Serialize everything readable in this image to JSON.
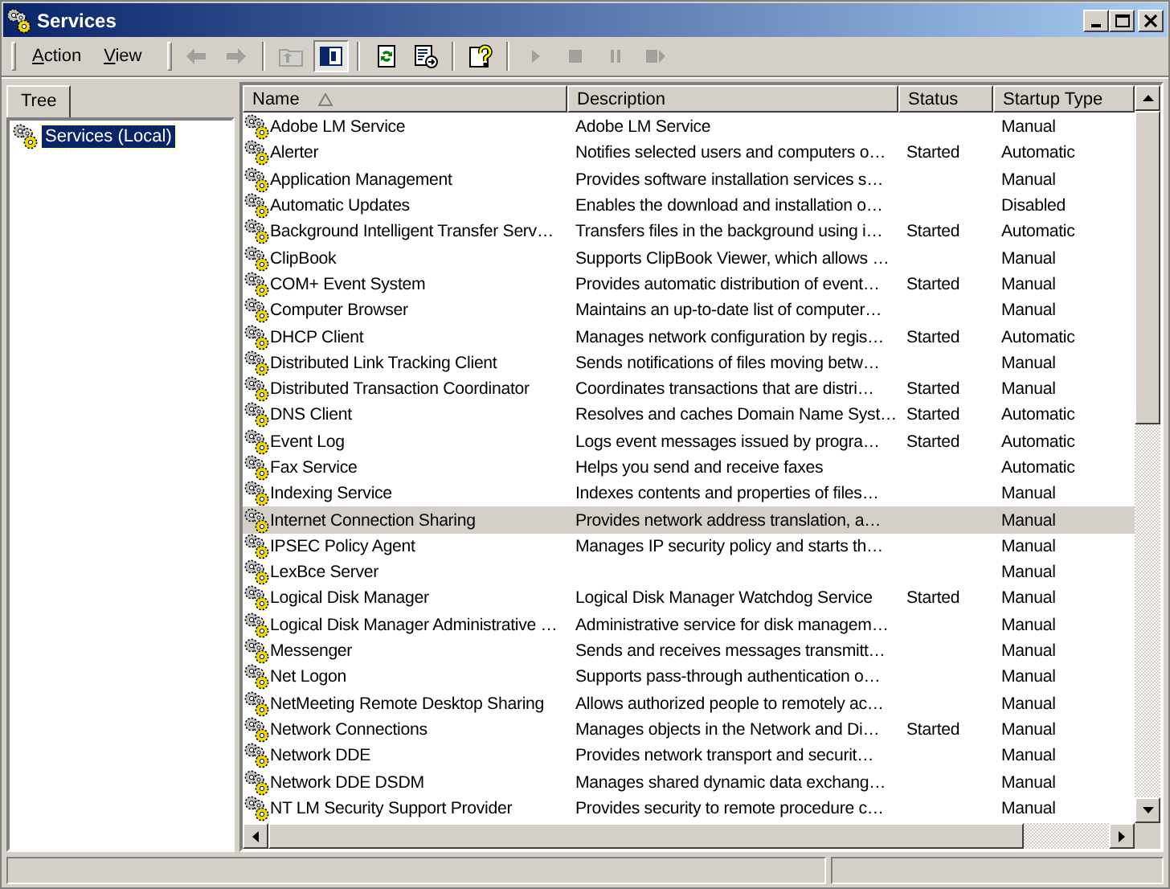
{
  "window": {
    "title": "Services"
  },
  "menu": [
    {
      "label": "Action"
    },
    {
      "label": "View"
    }
  ],
  "toolbar": [
    {
      "kind": "back",
      "disabled": true,
      "pressed": false
    },
    {
      "kind": "forward",
      "disabled": true,
      "pressed": false
    },
    {
      "kind": "sep"
    },
    {
      "kind": "up",
      "disabled": true,
      "pressed": false
    },
    {
      "kind": "tree",
      "disabled": false,
      "pressed": true
    },
    {
      "kind": "sep"
    },
    {
      "kind": "refresh",
      "disabled": false,
      "pressed": false
    },
    {
      "kind": "export",
      "disabled": false,
      "pressed": false
    },
    {
      "kind": "sep"
    },
    {
      "kind": "help",
      "disabled": false,
      "pressed": false
    },
    {
      "kind": "sep"
    },
    {
      "kind": "play",
      "disabled": true,
      "pressed": false
    },
    {
      "kind": "stop",
      "disabled": true,
      "pressed": false
    },
    {
      "kind": "pause",
      "disabled": true,
      "pressed": false
    },
    {
      "kind": "restart",
      "disabled": true,
      "pressed": false
    }
  ],
  "tree": {
    "tab": "Tree",
    "items": [
      {
        "label": "Services (Local)",
        "selected": true
      }
    ]
  },
  "table": {
    "columns": [
      {
        "label": "Name",
        "sorted": true
      },
      {
        "label": "Description",
        "sorted": false
      },
      {
        "label": "Status",
        "sorted": false
      },
      {
        "label": "Startup Type",
        "sorted": false
      }
    ],
    "rows": [
      {
        "name": "Adobe LM Service",
        "description": "Adobe LM Service",
        "startup": "Manual",
        "selected": false
      },
      {
        "name": "Alerter",
        "description": "Notifies selected users and computers o…",
        "status": "Started",
        "startup": "Automatic",
        "selected": false
      },
      {
        "name": "Application Management",
        "description": "Provides software installation services s…",
        "startup": "Manual",
        "selected": false
      },
      {
        "name": "Automatic Updates",
        "description": "Enables the download and installation o…",
        "startup": "Disabled",
        "selected": false
      },
      {
        "name": "Background Intelligent Transfer Serv…",
        "description": "Transfers files in the background using i…",
        "status": "Started",
        "startup": "Automatic",
        "selected": false
      },
      {
        "name": "ClipBook",
        "description": "Supports ClipBook Viewer, which allows …",
        "startup": "Manual",
        "selected": false
      },
      {
        "name": "COM+ Event System",
        "description": "Provides automatic distribution of event…",
        "status": "Started",
        "startup": "Manual",
        "selected": false
      },
      {
        "name": "Computer Browser",
        "description": "Maintains an up-to-date list of computer…",
        "startup": "Manual",
        "selected": false
      },
      {
        "name": "DHCP Client",
        "description": "Manages network configuration by regis…",
        "status": "Started",
        "startup": "Automatic",
        "selected": false
      },
      {
        "name": "Distributed Link Tracking Client",
        "description": "Sends notifications of files moving betw…",
        "startup": "Manual",
        "selected": false
      },
      {
        "name": "Distributed Transaction Coordinator",
        "description": "Coordinates transactions that are distri…",
        "status": "Started",
        "startup": "Manual",
        "selected": false
      },
      {
        "name": "DNS Client",
        "description": "Resolves and caches Domain Name Syst…",
        "status": "Started",
        "startup": "Automatic",
        "selected": false
      },
      {
        "name": "Event Log",
        "description": "Logs event messages issued by progra…",
        "status": "Started",
        "startup": "Automatic",
        "selected": false
      },
      {
        "name": "Fax Service",
        "description": "Helps you send and receive faxes",
        "startup": "Automatic",
        "selected": false
      },
      {
        "name": "Indexing Service",
        "description": "Indexes contents and properties of files…",
        "startup": "Manual",
        "selected": false
      },
      {
        "name": "Internet Connection Sharing",
        "description": "Provides network address translation, a…",
        "startup": "Manual",
        "selected": true
      },
      {
        "name": "IPSEC Policy Agent",
        "description": "Manages IP security policy and starts th…",
        "startup": "Manual",
        "selected": false
      },
      {
        "name": "LexBce Server",
        "startup": "Manual",
        "selected": false
      },
      {
        "name": "Logical Disk Manager",
        "description": "Logical Disk Manager Watchdog Service",
        "status": "Started",
        "startup": "Manual",
        "selected": false
      },
      {
        "name": "Logical Disk Manager Administrative …",
        "description": "Administrative service for disk managem…",
        "startup": "Manual",
        "selected": false
      },
      {
        "name": "Messenger",
        "description": "Sends and receives messages transmitt…",
        "startup": "Manual",
        "selected": false
      },
      {
        "name": "Net Logon",
        "description": "Supports pass-through authentication o…",
        "startup": "Manual",
        "selected": false
      },
      {
        "name": "NetMeeting Remote Desktop Sharing",
        "description": "Allows authorized people to remotely ac…",
        "startup": "Manual",
        "selected": false
      },
      {
        "name": "Network Connections",
        "description": "Manages objects in the Network and Di…",
        "status": "Started",
        "startup": "Manual",
        "selected": false
      },
      {
        "name": "Network DDE",
        "description": "Provides network transport and securit…",
        "startup": "Manual",
        "selected": false
      },
      {
        "name": "Network DDE DSDM",
        "description": "Manages shared dynamic data exchang…",
        "startup": "Manual",
        "selected": false
      },
      {
        "name": "NT LM Security Support Provider",
        "description": "Provides security to remote procedure c…",
        "startup": "Manual",
        "selected": false
      }
    ]
  }
}
